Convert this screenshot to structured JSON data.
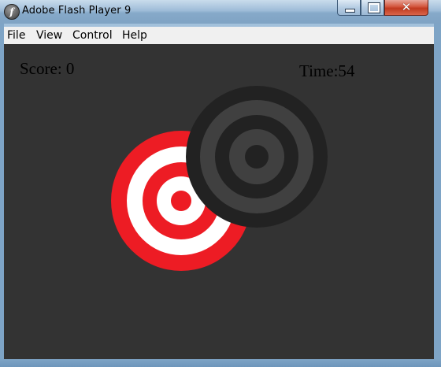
{
  "window": {
    "title": "Adobe Flash Player 9",
    "app_icon_glyph": "f",
    "controls": {
      "close_glyph": "✕"
    }
  },
  "menubar": {
    "items": [
      {
        "label": "File"
      },
      {
        "label": "View"
      },
      {
        "label": "Control"
      },
      {
        "label": "Help"
      }
    ]
  },
  "game": {
    "score_text": "Score: 0",
    "time_text": "Time:54",
    "stage_color": "#333333",
    "targets": [
      {
        "name": "red-target",
        "rings": [
          "#ed1c24",
          "#ffffff",
          "#ed1c24",
          "#ffffff",
          "#ed1c24"
        ]
      },
      {
        "name": "dark-target",
        "rings": [
          "#222222",
          "#404040",
          "#222222",
          "#404040",
          "#222222"
        ]
      }
    ]
  }
}
